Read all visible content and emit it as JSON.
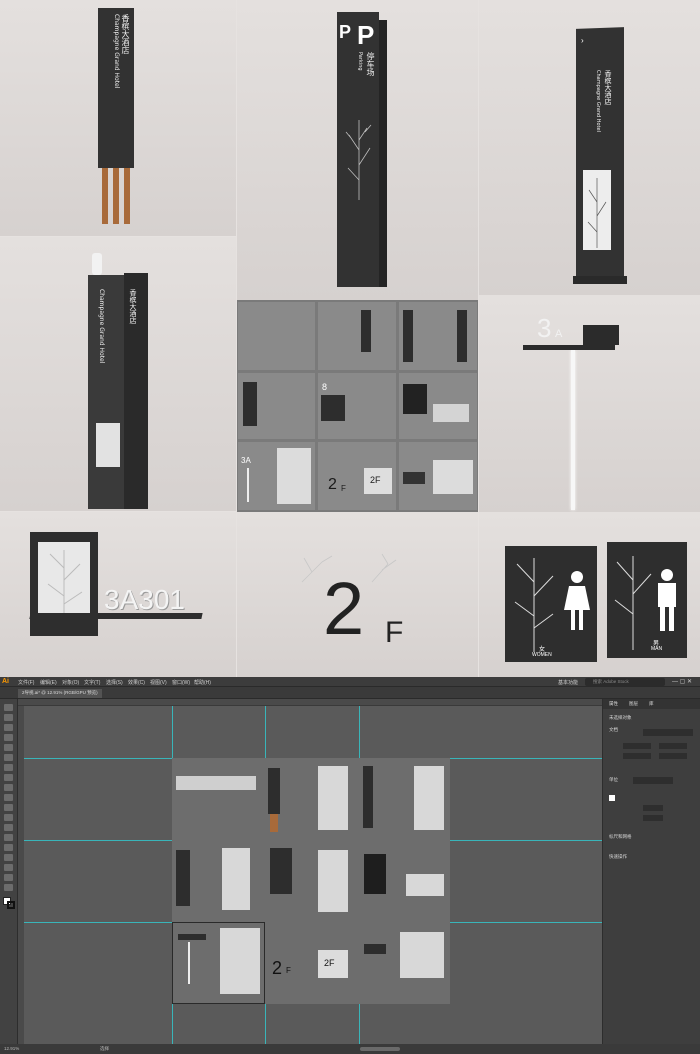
{
  "sign_totem": {
    "title_cn": "香槟大酒店",
    "title_en": "Champagne Grand Hotel"
  },
  "parking_totem": {
    "p_letter": "P",
    "title_cn": "停车场",
    "title_en": "Parking"
  },
  "directory_totem": {
    "title_cn": "香槟大酒店",
    "title_en": "Champagne Grand Hotel"
  },
  "floor_sign": {
    "label": "3",
    "suffix": "A"
  },
  "room_plate": {
    "number": "3A301"
  },
  "floor_level": {
    "digit": "2",
    "letter": "F"
  },
  "restroom": {
    "women_cn": "女",
    "women_en": "WOMEN",
    "men_cn": "男",
    "men_en": "MAN"
  },
  "thumbnails": {
    "floor_big": "2",
    "floor_f": "F",
    "floor_small": "2F",
    "room_code": "3A",
    "sign_num": "8"
  },
  "illustrator": {
    "app_logo": "Ai",
    "menus": [
      "文件(F)",
      "编辑(E)",
      "对象(O)",
      "文字(T)",
      "选择(S)",
      "效果(C)",
      "视图(V)",
      "窗口(W)",
      "帮助(H)"
    ],
    "doc_tab": "2导视.ai* @ 12.91% (RGB/GPU 预览)",
    "workspace": "基本功能",
    "search_placeholder": "搜索 Adobe Stock",
    "panel_tabs": [
      "属性",
      "图层",
      "库"
    ],
    "panel_label_artboard": "未选择对象",
    "panel_label_doc": "文档",
    "panel_label_units": "单位",
    "panel_label_ruler": "标尺和网格",
    "panel_label_quick": "快速操作",
    "zoom": "12.91%",
    "status": "选择"
  },
  "colors": {
    "sign_dark": "#323232",
    "wood": "#a86a3a",
    "ai_accent": "#ff9a00",
    "guide": "#39b5b9"
  }
}
